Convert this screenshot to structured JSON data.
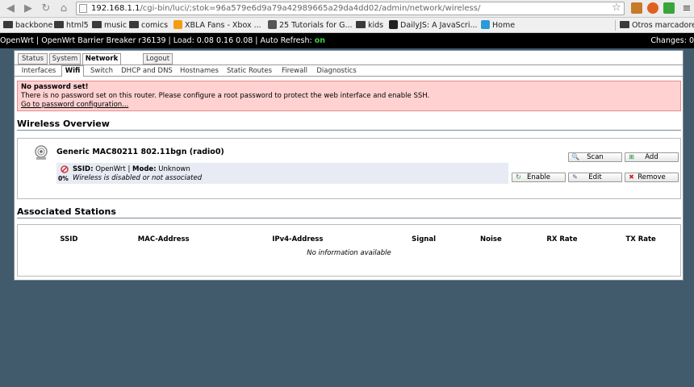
{
  "browser": {
    "url_host": "192.168.1.1",
    "url_path": "/cgi-bin/luci/;stok=96a579e6d9a79a42989665a29da4dd02/admin/network/wireless/"
  },
  "bookmarks": {
    "items": [
      {
        "label": "backbone",
        "icon": "folder-icon"
      },
      {
        "label": "html5",
        "icon": "folder-icon"
      },
      {
        "label": "music",
        "icon": "folder-icon"
      },
      {
        "label": "comics",
        "icon": "folder-icon"
      },
      {
        "label": "XBLA Fans - Xbox ...",
        "icon": "xbla-icon"
      },
      {
        "label": "25 Tutorials for G...",
        "icon": "tutorial-icon"
      },
      {
        "label": "kids",
        "icon": "folder-icon"
      },
      {
        "label": "DailyJS: A JavaScri...",
        "icon": "dailyjs-icon"
      },
      {
        "label": "Home",
        "icon": "home-w-icon"
      }
    ],
    "other": "Otros marcadores"
  },
  "header": {
    "prefix": "OpenWrt | OpenWrt Barrier Breaker r36139 | Load: 0.08 0.16 0.08 | Auto Refresh: ",
    "auto_refresh": "on",
    "changes": "Changes: 0"
  },
  "tabs": {
    "status": "Status",
    "system": "System",
    "network": "Network",
    "logout": "Logout"
  },
  "subtabs": {
    "interfaces": "Interfaces",
    "wifi": "Wifi",
    "switch": "Switch",
    "dhcp": "DHCP and DNS",
    "hostnames": "Hostnames",
    "routes": "Static Routes",
    "firewall": "Firewall",
    "diagnostics": "Diagnostics"
  },
  "alert": {
    "title": "No password set!",
    "message": "There is no password set on this router. Please configure a root password to protect the web interface and enable SSH.",
    "link": "Go to password configuration..."
  },
  "wireless": {
    "title": "Wireless Overview",
    "radio_name": "Generic MAC80211 802.11bgn (radio0)",
    "ssid_label": "SSID:",
    "ssid_value": "OpenWrt",
    "sep": "|",
    "mode_label": "Mode:",
    "mode_value": "Unknown",
    "signal_pct": "0%",
    "status_text": "Wireless is disabled or not associated",
    "scan": "Scan",
    "add": "Add",
    "enable": "Enable",
    "edit": "Edit",
    "remove": "Remove"
  },
  "stations": {
    "title": "Associated Stations",
    "columns": [
      "SSID",
      "MAC-Address",
      "IPv4-Address",
      "Signal",
      "Noise",
      "RX Rate",
      "TX Rate"
    ],
    "empty": "No information available"
  },
  "colors": {
    "background": "#415a6c",
    "alert_bg": "#ffd1d1",
    "auto_refresh_on": "#3cd13c"
  }
}
